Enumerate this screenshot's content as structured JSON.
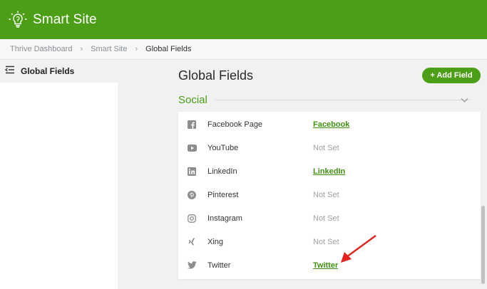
{
  "header": {
    "app_title": "Smart Site",
    "bg_color": "#4b9e16"
  },
  "breadcrumb": {
    "items": [
      "Thrive Dashboard",
      "Smart Site",
      "Global Fields"
    ]
  },
  "sidebar": {
    "title": "Global Fields"
  },
  "main": {
    "title": "Global Fields",
    "add_button_label": "+ Add Field",
    "section_title": "Social",
    "rows": [
      {
        "icon": "facebook-icon",
        "name": "Facebook Page",
        "value": "Facebook",
        "is_set": true
      },
      {
        "icon": "youtube-icon",
        "name": "YouTube",
        "value": "Not Set",
        "is_set": false
      },
      {
        "icon": "linkedin-icon",
        "name": "LinkedIn",
        "value": "LinkedIn",
        "is_set": true
      },
      {
        "icon": "pinterest-icon",
        "name": "Pinterest",
        "value": "Not Set",
        "is_set": false
      },
      {
        "icon": "instagram-icon",
        "name": "Instagram",
        "value": "Not Set",
        "is_set": false
      },
      {
        "icon": "xing-icon",
        "name": "Xing",
        "value": "Not Set",
        "is_set": false
      },
      {
        "icon": "twitter-icon",
        "name": "Twitter",
        "value": "Twitter",
        "is_set": true
      }
    ]
  },
  "annotation": {
    "arrow_color": "#e3231c"
  }
}
